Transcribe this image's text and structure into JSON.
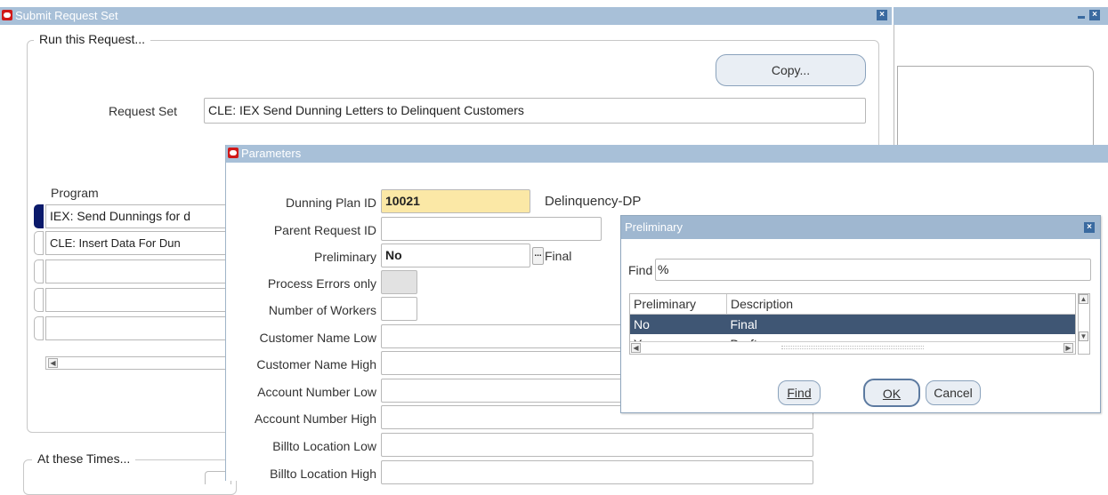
{
  "submit_window": {
    "title": "Submit Request Set",
    "run_group_title": "Run this Request...",
    "copy_button": "Copy...",
    "request_set_label": "Request Set",
    "request_set_value": "CLE: IEX Send Dunning Letters to Delinquent Customers",
    "program_header": "Program",
    "programs": [
      "IEX: Send Dunnings for d",
      "CLE: Insert Data For Dun",
      "",
      "",
      ""
    ],
    "times_group_title": "At these Times..."
  },
  "parameters_window": {
    "title": "Parameters",
    "fields": [
      {
        "label": "Dunning Plan ID",
        "value": "10021",
        "desc": "Delinquency-DP"
      },
      {
        "label": "Parent Request ID",
        "value": ""
      },
      {
        "label": "Preliminary",
        "value": "No",
        "desc": "Final"
      },
      {
        "label": "Process Errors only",
        "value": ""
      },
      {
        "label": "Number of Workers",
        "value": ""
      },
      {
        "label": "Customer Name Low",
        "value": ""
      },
      {
        "label": "Customer Name High",
        "value": ""
      },
      {
        "label": "Account Number Low",
        "value": ""
      },
      {
        "label": "Account Number High",
        "value": ""
      },
      {
        "label": "Billto Location Low",
        "value": ""
      },
      {
        "label": "Billto Location High",
        "value": ""
      }
    ],
    "lov_button": "..."
  },
  "lov_dialog": {
    "title": "Preliminary",
    "find_label": "Find",
    "find_value": "%",
    "columns": [
      "Preliminary",
      "Description"
    ],
    "rows": [
      {
        "value": "No",
        "desc": "Final"
      },
      {
        "value": "Yes",
        "desc": "Draft"
      }
    ],
    "find_button": "Find",
    "ok_button": "OK",
    "cancel_button": "Cancel"
  },
  "colors": {
    "titlebar": "#a8c0d8",
    "required_field": "#fbe8a6",
    "selected_row": "#3f5674",
    "selector_active": "#0b1a6b"
  }
}
